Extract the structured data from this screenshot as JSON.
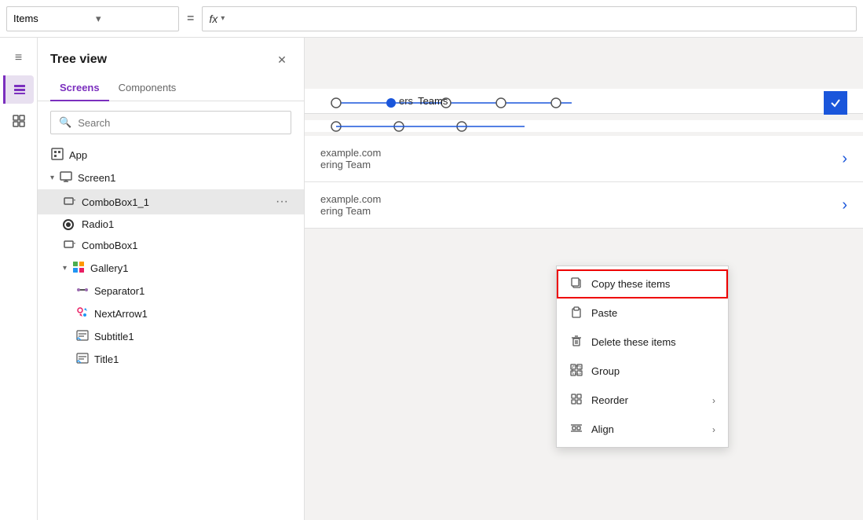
{
  "topbar": {
    "dropdown_label": "Items",
    "equals": "=",
    "fx_label": "fx"
  },
  "tree_view": {
    "title": "Tree view",
    "tabs": [
      "Screens",
      "Components"
    ],
    "active_tab": "Screens",
    "search_placeholder": "Search",
    "items": [
      {
        "id": "app",
        "label": "App",
        "indent": 0,
        "icon": "app",
        "expanded": false
      },
      {
        "id": "screen1",
        "label": "Screen1",
        "indent": 0,
        "icon": "screen",
        "expanded": true
      },
      {
        "id": "combobox1_1",
        "label": "ComboBox1_1",
        "indent": 1,
        "icon": "combobox",
        "expanded": false,
        "has_more": true
      },
      {
        "id": "radio1",
        "label": "Radio1",
        "indent": 1,
        "icon": "radio",
        "expanded": false
      },
      {
        "id": "combobox1",
        "label": "ComboBox1",
        "indent": 1,
        "icon": "combobox",
        "expanded": false
      },
      {
        "id": "gallery1",
        "label": "Gallery1",
        "indent": 1,
        "icon": "gallery",
        "expanded": true
      },
      {
        "id": "separator1",
        "label": "Separator1",
        "indent": 2,
        "icon": "separator",
        "expanded": false
      },
      {
        "id": "nextarrow1",
        "label": "NextArrow1",
        "indent": 2,
        "icon": "nextarrow",
        "expanded": false
      },
      {
        "id": "subtitle1",
        "label": "Subtitle1",
        "indent": 2,
        "icon": "text",
        "expanded": false
      },
      {
        "id": "title1",
        "label": "Title1",
        "indent": 2,
        "icon": "text",
        "expanded": false
      }
    ]
  },
  "context_menu": {
    "items": [
      {
        "id": "copy",
        "label": "Copy these items",
        "icon": "copy",
        "highlighted": true
      },
      {
        "id": "paste",
        "label": "Paste",
        "icon": "paste",
        "highlighted": false
      },
      {
        "id": "delete",
        "label": "Delete these items",
        "icon": "delete",
        "highlighted": false
      },
      {
        "id": "group",
        "label": "Group",
        "icon": "group",
        "highlighted": false
      },
      {
        "id": "reorder",
        "label": "Reorder",
        "icon": "reorder",
        "has_arrow": true,
        "highlighted": false
      },
      {
        "id": "align",
        "label": "Align",
        "icon": "align",
        "has_arrow": true,
        "highlighted": false
      }
    ]
  },
  "canvas": {
    "tab_labels": [
      "ers",
      "Teams"
    ],
    "rows": [
      {
        "title": "example.com",
        "subtitle": "ering Team"
      },
      {
        "title": "example.com",
        "subtitle": "ering Team"
      }
    ]
  },
  "left_nav": {
    "icons": [
      {
        "id": "hamburger",
        "symbol": "≡",
        "active": false
      },
      {
        "id": "layers",
        "symbol": "⧉",
        "active": true
      },
      {
        "id": "components",
        "symbol": "⊞",
        "active": false
      }
    ]
  }
}
